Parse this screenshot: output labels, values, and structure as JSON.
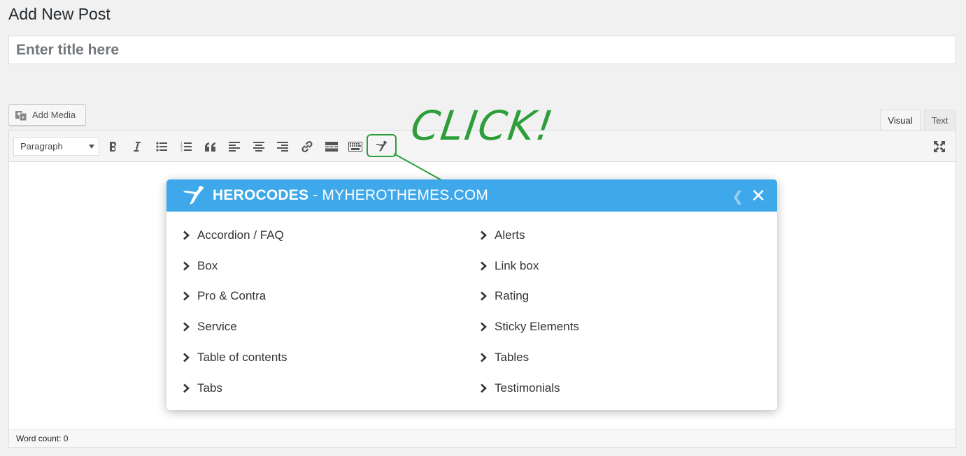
{
  "page": {
    "title": "Add New Post"
  },
  "title_field": {
    "placeholder": "Enter title here",
    "value": ""
  },
  "add_media": {
    "label": "Add Media"
  },
  "editor_tabs": {
    "visual": "Visual",
    "text": "Text"
  },
  "toolbar": {
    "format_select": "Paragraph",
    "buttons": [
      "bold-icon",
      "italic-icon",
      "bullet-list-icon",
      "numbered-list-icon",
      "blockquote-icon",
      "align-left-icon",
      "align-center-icon",
      "align-right-icon",
      "link-icon",
      "read-more-icon",
      "toolbar-toggle-icon",
      "herocodes-icon",
      "fullscreen-icon"
    ]
  },
  "annotation": {
    "text": "CLICK!",
    "color": "#2e9e3b"
  },
  "popup": {
    "brand": "HEROCODES",
    "separator": " - ",
    "site": "MYHEROTHEMES.COM",
    "header_color": "#3ea8ea",
    "items": [
      "Accordion / FAQ",
      "Alerts",
      "Box",
      "Link box",
      "Pro & Contra",
      "Rating",
      "Service",
      "Sticky Elements",
      "Table of contents",
      "Tables",
      "Tabs",
      "Testimonials"
    ]
  },
  "status": {
    "word_count": "Word count: 0"
  }
}
